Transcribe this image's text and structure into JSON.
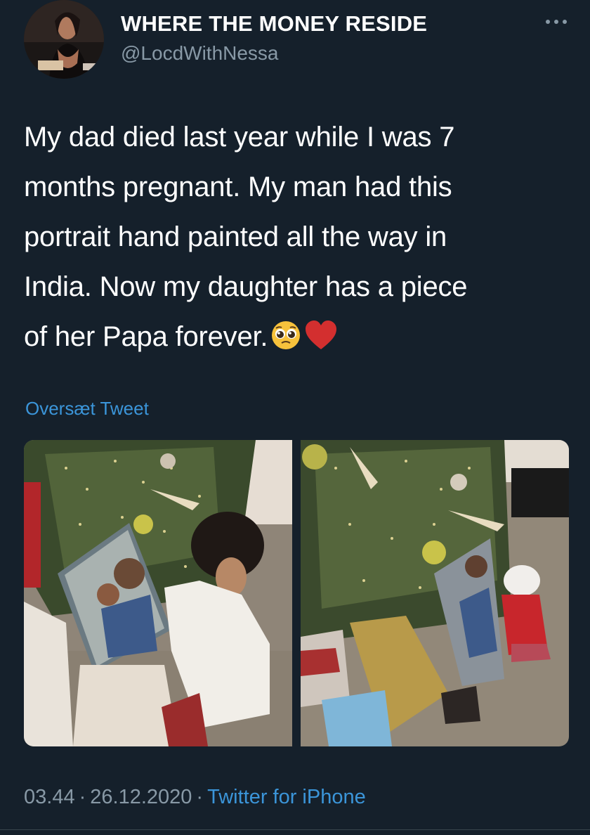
{
  "tweet": {
    "display_name": "WHERE THE MONEY RESIDE",
    "handle": "@LocdWithNessa",
    "text_lines": [
      "My dad died last year while I was 7",
      "months pregnant. My man had this",
      "portrait hand painted all the way in",
      "India. Now my daughter has a piece",
      "of her Papa forever."
    ],
    "emojis": [
      "pleading-face-emoji",
      "red-heart-emoji"
    ],
    "translate_label": "Oversæt Tweet",
    "time": "03.44",
    "date": "26.12.2020",
    "separator": "·",
    "source": "Twitter for iPhone"
  },
  "icons": {
    "more": "more-horizontal-icon"
  },
  "colors": {
    "background": "#15202b",
    "text": "#ffffff",
    "secondary_text": "#8899a6",
    "link": "#3b95d9",
    "divider": "#38444d"
  }
}
